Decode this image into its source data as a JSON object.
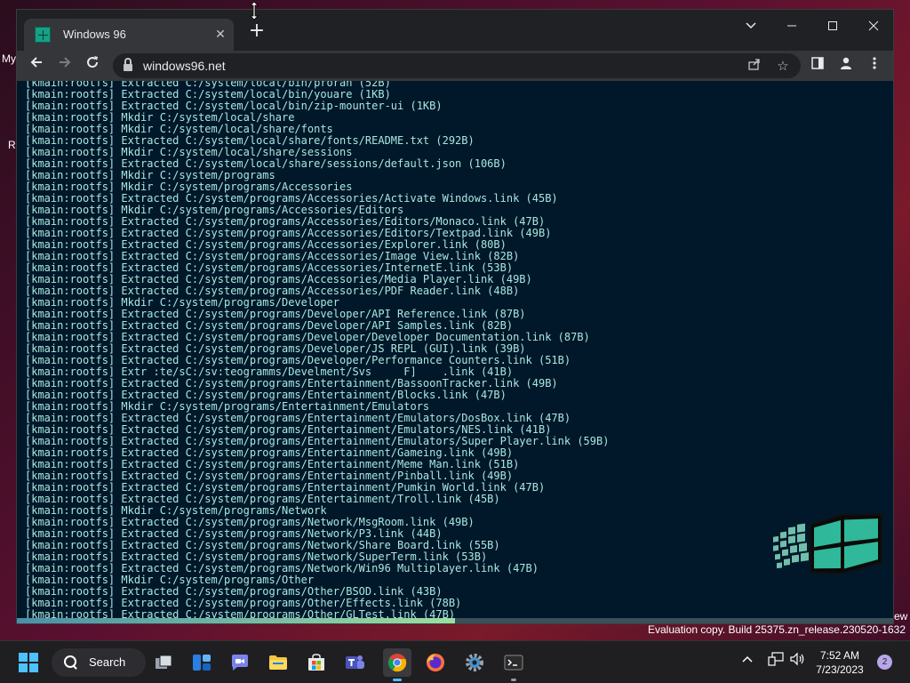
{
  "desktop": {
    "partial_left_top": "My",
    "partial_left_mid": "Re",
    "partial_right": "ew"
  },
  "browser": {
    "tab_title": "Windows 96",
    "url": "windows96.net",
    "icons": {
      "tab_close": "close-icon",
      "new_tab": "plus-icon",
      "tab_search": "chevron-down-icon",
      "minimize": "minimize-icon",
      "maximize": "maximize-icon",
      "close": "close-icon",
      "back": "arrow-left-icon",
      "forward": "arrow-right-icon",
      "reload": "reload-icon",
      "lock": "lock-icon",
      "share": "share-icon",
      "bookmark": "star-icon",
      "side_panel": "side-panel-icon",
      "profile": "profile-icon",
      "menu": "kebab-menu-icon"
    }
  },
  "terminal": {
    "text_color": "#a8e8e0",
    "background": "#01182a",
    "progress_fraction": 0.5,
    "lines": [
      "[kmain:rootfs] Extracted C:/system/local/bin/proran (52B)",
      "[kmain:rootfs] Extracted C:/system/local/bin/youare (1KB)",
      "[kmain:rootfs] Extracted C:/system/local/bin/zip-mounter-ui (1KB)",
      "[kmain:rootfs] Mkdir C:/system/local/share",
      "[kmain:rootfs] Mkdir C:/system/local/share/fonts",
      "[kmain:rootfs] Extracted C:/system/local/share/fonts/README.txt (292B)",
      "[kmain:rootfs] Mkdir C:/system/local/share/sessions",
      "[kmain:rootfs] Extracted C:/system/local/share/sessions/default.json (106B)",
      "[kmain:rootfs] Mkdir C:/system/programs",
      "[kmain:rootfs] Mkdir C:/system/programs/Accessories",
      "[kmain:rootfs] Extracted C:/system/programs/Accessories/Activate Windows.link (45B)",
      "[kmain:rootfs] Mkdir C:/system/programs/Accessories/Editors",
      "[kmain:rootfs] Extracted C:/system/programs/Accessories/Editors/Monaco.link (47B)",
      "[kmain:rootfs] Extracted C:/system/programs/Accessories/Editors/Textpad.link (49B)",
      "[kmain:rootfs] Extracted C:/system/programs/Accessories/Explorer.link (80B)",
      "[kmain:rootfs] Extracted C:/system/programs/Accessories/Image View.link (82B)",
      "[kmain:rootfs] Extracted C:/system/programs/Accessories/InternetE.link (53B)",
      "[kmain:rootfs] Extracted C:/system/programs/Accessories/Media Player.link (49B)",
      "[kmain:rootfs] Extracted C:/system/programs/Accessories/PDF Reader.link (48B)",
      "[kmain:rootfs] Mkdir C:/system/programs/Developer",
      "[kmain:rootfs] Extracted C:/system/programs/Developer/API Reference.link (87B)",
      "[kmain:rootfs] Extracted C:/system/programs/Developer/API Samples.link (82B)",
      "[kmain:rootfs] Extracted C:/system/programs/Developer/Developer Documentation.link (87B)",
      "[kmain:rootfs] Extracted C:/system/programs/Developer/JS REPL (GUI).link (39B)",
      "[kmain:rootfs] Extracted C:/system/programs/Developer/Performance Counters.link (51B)",
      "[kmain:rootfs] Extr :te/sC:/sv:teogramms/Develment/Svs     F]    .link (41B)",
      "[kmain:rootfs] Extracted C:/system/programs/Entertainment/BassoonTracker.link (49B)",
      "[kmain:rootfs] Extracted C:/system/programs/Entertainment/Blocks.link (47B)",
      "[kmain:rootfs] Mkdir C:/system/programs/Entertainment/Emulators",
      "[kmain:rootfs] Extracted C:/system/programs/Entertainment/Emulators/DosBox.link (47B)",
      "[kmain:rootfs] Extracted C:/system/programs/Entertainment/Emulators/NES.link (41B)",
      "[kmain:rootfs] Extracted C:/system/programs/Entertainment/Emulators/Super Player.link (59B)",
      "[kmain:rootfs] Extracted C:/system/programs/Entertainment/Gameing.link (49B)",
      "[kmain:rootfs] Extracted C:/system/programs/Entertainment/Meme Man.link (51B)",
      "[kmain:rootfs] Extracted C:/system/programs/Entertainment/Pinball.link (49B)",
      "[kmain:rootfs] Extracted C:/system/programs/Entertainment/Pumkin World.link (47B)",
      "[kmain:rootfs] Extracted C:/system/programs/Entertainment/Troll.link (45B)",
      "[kmain:rootfs] Mkdir C:/system/programs/Network",
      "[kmain:rootfs] Extracted C:/system/programs/Network/MsgRoom.link (49B)",
      "[kmain:rootfs] Extracted C:/system/programs/Network/P3.link (44B)",
      "[kmain:rootfs] Extracted C:/system/programs/Network/Share Board.link (55B)",
      "[kmain:rootfs] Extracted C:/system/programs/Network/SuperTerm.link (53B)",
      "[kmain:rootfs] Extracted C:/system/programs/Network/Win96 Multiplayer.link (47B)",
      "[kmain:rootfs] Mkdir C:/system/programs/Other",
      "[kmain:rootfs] Extracted C:/system/programs/Other/BSOD.link (43B)",
      "[kmain:rootfs] Extracted C:/system/programs/Other/Effects.link (78B)",
      "[kmain:rootfs] Extracted C:/system/programs/Other/GLTest.link (47B)"
    ]
  },
  "watermark": {
    "text": "Evaluation copy. Build 25375.zn_release.230520-1632"
  },
  "taskbar": {
    "search_label": "Search",
    "time": "7:52 AM",
    "date": "7/23/2023",
    "notification_count": "2",
    "accent_color": "#4cc2ff",
    "apps": [
      {
        "name": "task-view",
        "icon": "task-view-icon"
      },
      {
        "name": "widgets",
        "icon": "widgets-icon"
      },
      {
        "name": "chat",
        "icon": "chat-icon"
      },
      {
        "name": "file-explorer",
        "icon": "folder-icon"
      },
      {
        "name": "store",
        "icon": "store-icon"
      },
      {
        "name": "teams",
        "icon": "teams-icon"
      },
      {
        "name": "chrome",
        "icon": "chrome-icon"
      },
      {
        "name": "firefox",
        "icon": "firefox-icon"
      },
      {
        "name": "settings",
        "icon": "gear-icon"
      },
      {
        "name": "terminal",
        "icon": "terminal-icon"
      }
    ]
  }
}
